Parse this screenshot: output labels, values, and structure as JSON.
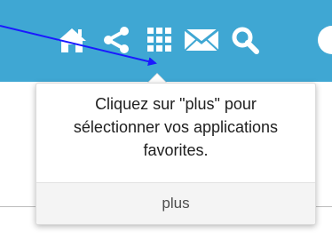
{
  "topbar": {
    "background": "#3fa7d3",
    "icons": [
      {
        "name": "home-icon",
        "color": "#ffffff"
      },
      {
        "name": "share-icon",
        "color": "#ffffff"
      },
      {
        "name": "apps-grid-icon",
        "color": "#ffffff"
      },
      {
        "name": "mail-icon",
        "color": "#ffffff"
      },
      {
        "name": "search-icon",
        "color": "#ffffff"
      },
      {
        "name": "user-avatar-icon",
        "color": "#ffffff"
      }
    ]
  },
  "popover": {
    "message_line1": "Cliquez sur \"plus\" pour",
    "message_line2": "sélectionner vos applications",
    "message_line3": "favorites.",
    "footer_label": "plus"
  },
  "annotation": {
    "arrow_color": "#1a1aff"
  }
}
